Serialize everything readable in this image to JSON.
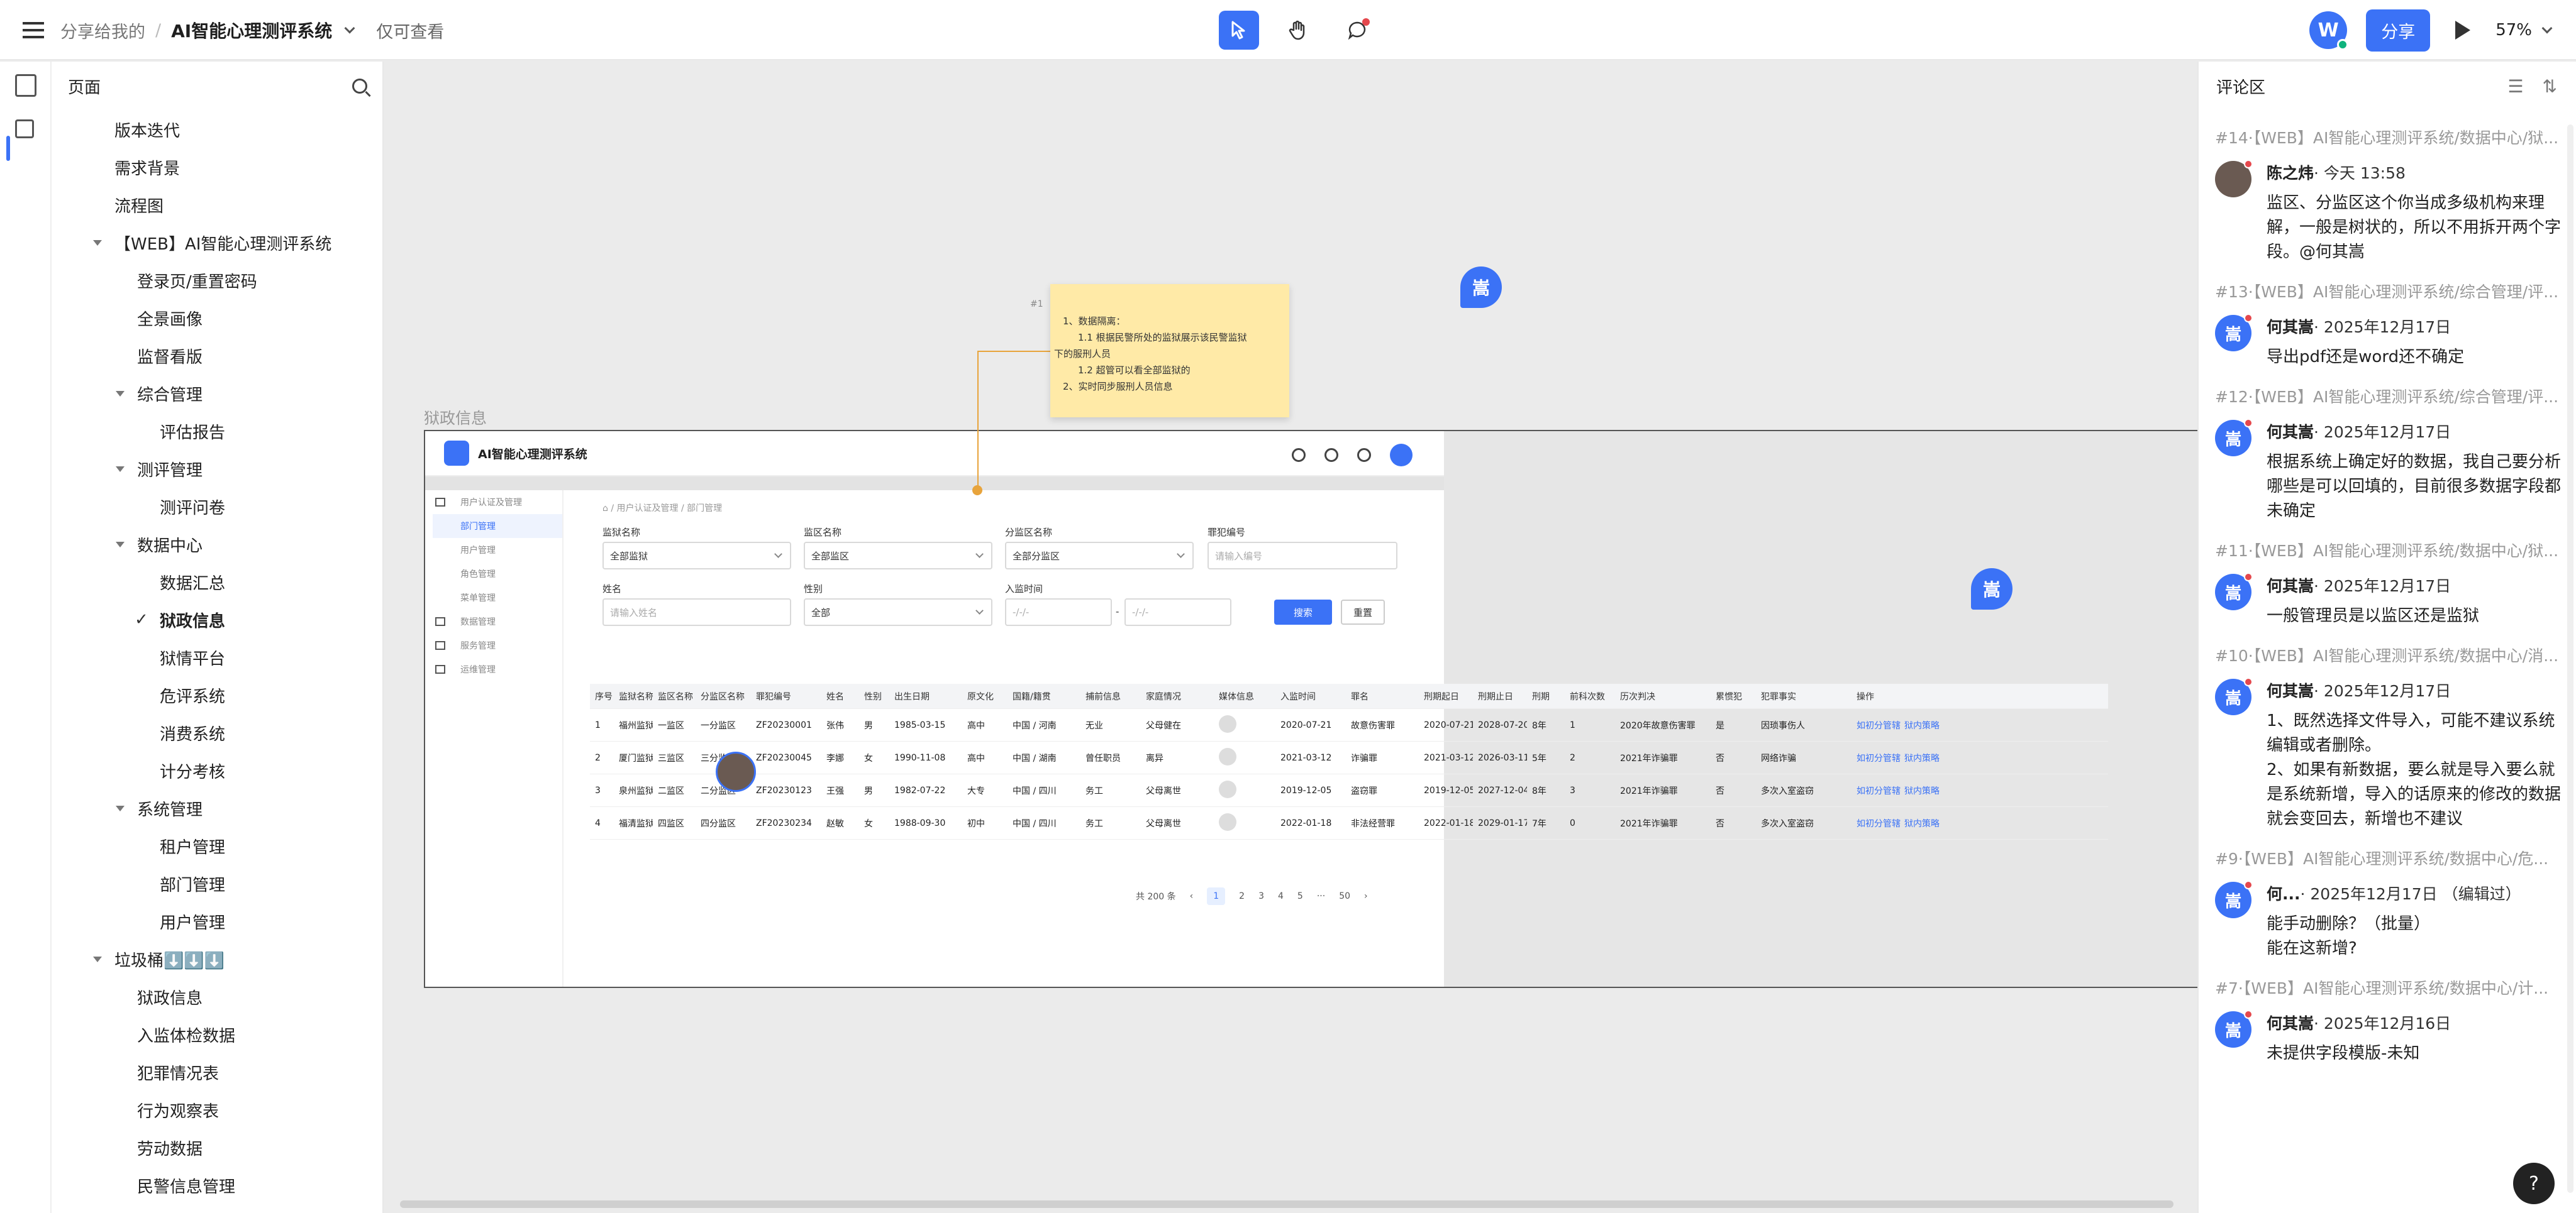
{
  "topbar": {
    "breadcrumb_root": "分享给我的",
    "doc_title": "AI智能心理测评系统",
    "mode": "仅可查看",
    "user_initial": "W",
    "share_label": "分享",
    "zoom": "57%"
  },
  "sidebar": {
    "title": "页面",
    "items": [
      {
        "label": "版本迭代",
        "level": 1,
        "arrow": false
      },
      {
        "label": "需求背景",
        "level": 1,
        "arrow": false
      },
      {
        "label": "流程图",
        "level": 1,
        "arrow": false
      },
      {
        "label": "【WEB】AI智能心理测评系统",
        "level": 1,
        "arrow": true
      },
      {
        "label": "登录页/重置密码",
        "level": 2,
        "arrow": false
      },
      {
        "label": "全景画像",
        "level": 2,
        "arrow": false
      },
      {
        "label": "监督看版",
        "level": 2,
        "arrow": false
      },
      {
        "label": "综合管理",
        "level": 2,
        "arrow": true
      },
      {
        "label": "评估报告",
        "level": 3,
        "arrow": false
      },
      {
        "label": "测评管理",
        "level": 2,
        "arrow": true
      },
      {
        "label": "测评问卷",
        "level": 3,
        "arrow": false
      },
      {
        "label": "数据中心",
        "level": 2,
        "arrow": true
      },
      {
        "label": "数据汇总",
        "level": 3,
        "arrow": false
      },
      {
        "label": "狱政信息",
        "level": 3,
        "arrow": false,
        "selected": true
      },
      {
        "label": "狱情平台",
        "level": 3,
        "arrow": false
      },
      {
        "label": "危评系统",
        "level": 3,
        "arrow": false
      },
      {
        "label": "消费系统",
        "level": 3,
        "arrow": false
      },
      {
        "label": "计分考核",
        "level": 3,
        "arrow": false
      },
      {
        "label": "系统管理",
        "level": 2,
        "arrow": true
      },
      {
        "label": "租户管理",
        "level": 3,
        "arrow": false
      },
      {
        "label": "部门管理",
        "level": 3,
        "arrow": false
      },
      {
        "label": "用户管理",
        "level": 3,
        "arrow": false
      },
      {
        "label": "垃圾桶⬇️⬇️⬇️",
        "level": 1,
        "arrow": true
      },
      {
        "label": "狱政信息",
        "level": 2,
        "arrow": false
      },
      {
        "label": "入监体检数据",
        "level": 2,
        "arrow": false
      },
      {
        "label": "犯罪情况表",
        "level": 2,
        "arrow": false
      },
      {
        "label": "行为观察表",
        "level": 2,
        "arrow": false
      },
      {
        "label": "劳动数据",
        "level": 2,
        "arrow": false
      },
      {
        "label": "民警信息管理",
        "level": 2,
        "arrow": false
      }
    ]
  },
  "canvas": {
    "frame_label": "狱政信息",
    "cursor_label": "嵩",
    "sticky": {
      "id": "#1",
      "lines": [
        "1、数据隔离：",
        "1.1 根据民警所处的监狱展示该民警监狱",
        "下的服刑人员",
        "1.2 超管可以看全部监狱的",
        "2、实时同步服刑人员信息"
      ]
    },
    "app": {
      "title": "AI智能心理测评系统",
      "side": [
        {
          "label": "用户认证及管理",
          "icon": true
        },
        {
          "label": "部门管理",
          "selected": true
        },
        {
          "label": "用户管理"
        },
        {
          "label": "角色管理"
        },
        {
          "label": "菜单管理"
        },
        {
          "label": "数据管理",
          "icon": true
        },
        {
          "label": "服务管理",
          "icon": true
        },
        {
          "label": "运维管理",
          "icon": true
        }
      ],
      "crumb": "⌂ / 用户认证及管理 / 部门管理",
      "filters": {
        "prison_label": "监狱名称",
        "prison_value": "全部监狱",
        "area_label": "监区名称",
        "area_value": "全部监区",
        "subarea_label": "分监区名称",
        "subarea_value": "全部分监区",
        "code_label": "罪犯编号",
        "code_placeholder": "请输入编号",
        "name_label": "姓名",
        "name_placeholder": "请输入姓名",
        "gender_label": "性别",
        "gender_value": "全部",
        "date_label": "入监时间",
        "date_placeholder": "-/-/-",
        "search_label": "搜索",
        "reset_label": "重置"
      },
      "columns": [
        "序号",
        "监狱名称",
        "监区名称",
        "分监区名称",
        "罪犯编号",
        "姓名",
        "性别",
        "出生日期",
        "原文化",
        "国籍/籍贯",
        "捕前信息",
        "家庭情况",
        "媒体信息",
        "入监时间",
        "罪名",
        "刑期起日",
        "刑期止日",
        "刑期",
        "前科次数",
        "历次判决",
        "累惯犯",
        "犯罪事实",
        "操作"
      ],
      "rows": [
        [
          "1",
          "福州监狱",
          "一监区",
          "一分监区",
          "ZF20230001",
          "张伟",
          "男",
          "1985-03-15",
          "高中",
          "中国 / 河南",
          "无业",
          "父母健在",
          "",
          "2020-07-21",
          "故意伤害罪",
          "2020-07-21",
          "2028-07-20",
          "8年",
          "1",
          "2020年故意伤害罪",
          "是",
          "因琐事伤人"
        ],
        [
          "2",
          "厦门监狱",
          "三监区",
          "三分监区",
          "ZF20230045",
          "李娜",
          "女",
          "1990-11-08",
          "高中",
          "中国 / 湖南",
          "曾任职员",
          "离异",
          "",
          "2021-03-12",
          "诈骗罪",
          "2021-03-12",
          "2026-03-11",
          "5年",
          "2",
          "2021年诈骗罪",
          "否",
          "网络诈骗"
        ],
        [
          "3",
          "泉州监狱",
          "二监区",
          "二分监区",
          "ZF20230123",
          "王强",
          "男",
          "1982-07-22",
          "大专",
          "中国 / 四川",
          "务工",
          "父母离世",
          "",
          "2019-12-05",
          "盗窃罪",
          "2019-12-05",
          "2027-12-04",
          "8年",
          "3",
          "2021年诈骗罪",
          "否",
          "多次入室盗窃"
        ],
        [
          "4",
          "福清监狱",
          "四监区",
          "四分监区",
          "ZF20230234",
          "赵敏",
          "女",
          "1988-09-30",
          "初中",
          "中国 / 四川",
          "务工",
          "父母离世",
          "",
          "2022-01-18",
          "非法经营罪",
          "2022-01-18",
          "2029-01-17",
          "7年",
          "0",
          "2021年诈骗罪",
          "否",
          "多次入室盗窃"
        ]
      ],
      "actions": [
        "如初分管辖",
        "狱内策略"
      ],
      "pager": {
        "total": "共 200 条",
        "pages": [
          "1",
          "2",
          "3",
          "4",
          "5",
          "···",
          "50"
        ],
        "prev": "‹",
        "next": "›"
      }
    }
  },
  "comments": {
    "title": "评论区",
    "threads": [
      {
        "title": "#14·【WEB】AI智能心理测评系统/数据中心/狱...",
        "author": "陈之炜",
        "time": "· 今天 13:58",
        "avatar": "",
        "photo": true,
        "text": "监区、分监区这个你当成多级机构来理解，一般是树状的，所以不用拆开两个字段。@何其嵩"
      },
      {
        "title": "#13·【WEB】AI智能心理测评系统/综合管理/评...",
        "author": "何其嵩",
        "time": "· 2025年12月17日",
        "avatar": "嵩",
        "text": "导出pdf还是word还不确定"
      },
      {
        "title": "#12·【WEB】AI智能心理测评系统/综合管理/评...",
        "author": "何其嵩",
        "time": "· 2025年12月17日",
        "avatar": "嵩",
        "text": "根据系统上确定好的数据，我自己要分析哪些是可以回填的，目前很多数据字段都未确定"
      },
      {
        "title": "#11·【WEB】AI智能心理测评系统/数据中心/狱...",
        "author": "何其嵩",
        "time": "· 2025年12月17日",
        "avatar": "嵩",
        "text": "一般管理员是以监区还是监狱"
      },
      {
        "title": "#10·【WEB】AI智能心理测评系统/数据中心/消...",
        "author": "何其嵩",
        "time": "· 2025年12月17日",
        "avatar": "嵩",
        "text": "1、既然选择文件导入，可能不建议系统编辑或者删除。\n2、如果有新数据，要么就是导入要么就是系统新增，导入的话原来的修改的数据就会变回去，新增也不建议"
      },
      {
        "title": "#9·【WEB】AI智能心理测评系统/数据中心/危...",
        "author": "何...",
        "time": "· 2025年12月17日 （编辑过）",
        "avatar": "嵩",
        "text": "能手动删除？（批量）\n能在这新增?"
      },
      {
        "title": "#7·【WEB】AI智能心理测评系统/数据中心/计...",
        "author": "何其嵩",
        "time": "· 2025年12月16日",
        "avatar": "嵩",
        "text": "未提供字段模版-未知"
      }
    ]
  },
  "help_label": "?"
}
